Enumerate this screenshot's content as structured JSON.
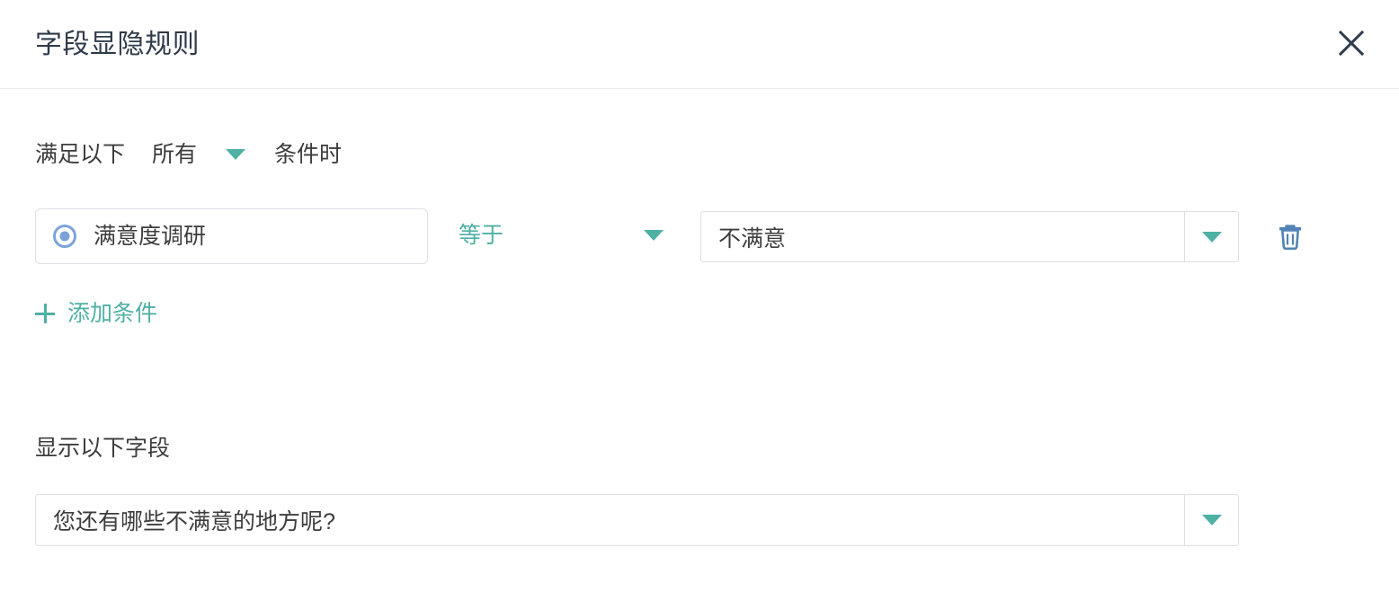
{
  "dialog": {
    "title": "字段显隐规则",
    "close_icon": "close-icon"
  },
  "conditions_section": {
    "match_prefix": "满足以下",
    "match_mode": "所有",
    "match_suffix": "条件时",
    "rows": [
      {
        "field_icon": "radio-button-icon",
        "field_label": "满意度调研",
        "operator": "等于",
        "value": "不满意",
        "delete_icon": "trash-icon"
      }
    ],
    "add_condition_label": "添加条件",
    "add_condition_icon": "plus-icon"
  },
  "show_fields_section": {
    "label": "显示以下字段",
    "selected_field": "您还有哪些不满意的地方呢?"
  },
  "colors": {
    "accent_teal": "#4fb0a4",
    "radio_blue": "#7ca3d8",
    "trash_blue": "#5183b5",
    "border": "#dcdfe6",
    "text": "#3d3d3d",
    "title": "#2f3a4a"
  }
}
